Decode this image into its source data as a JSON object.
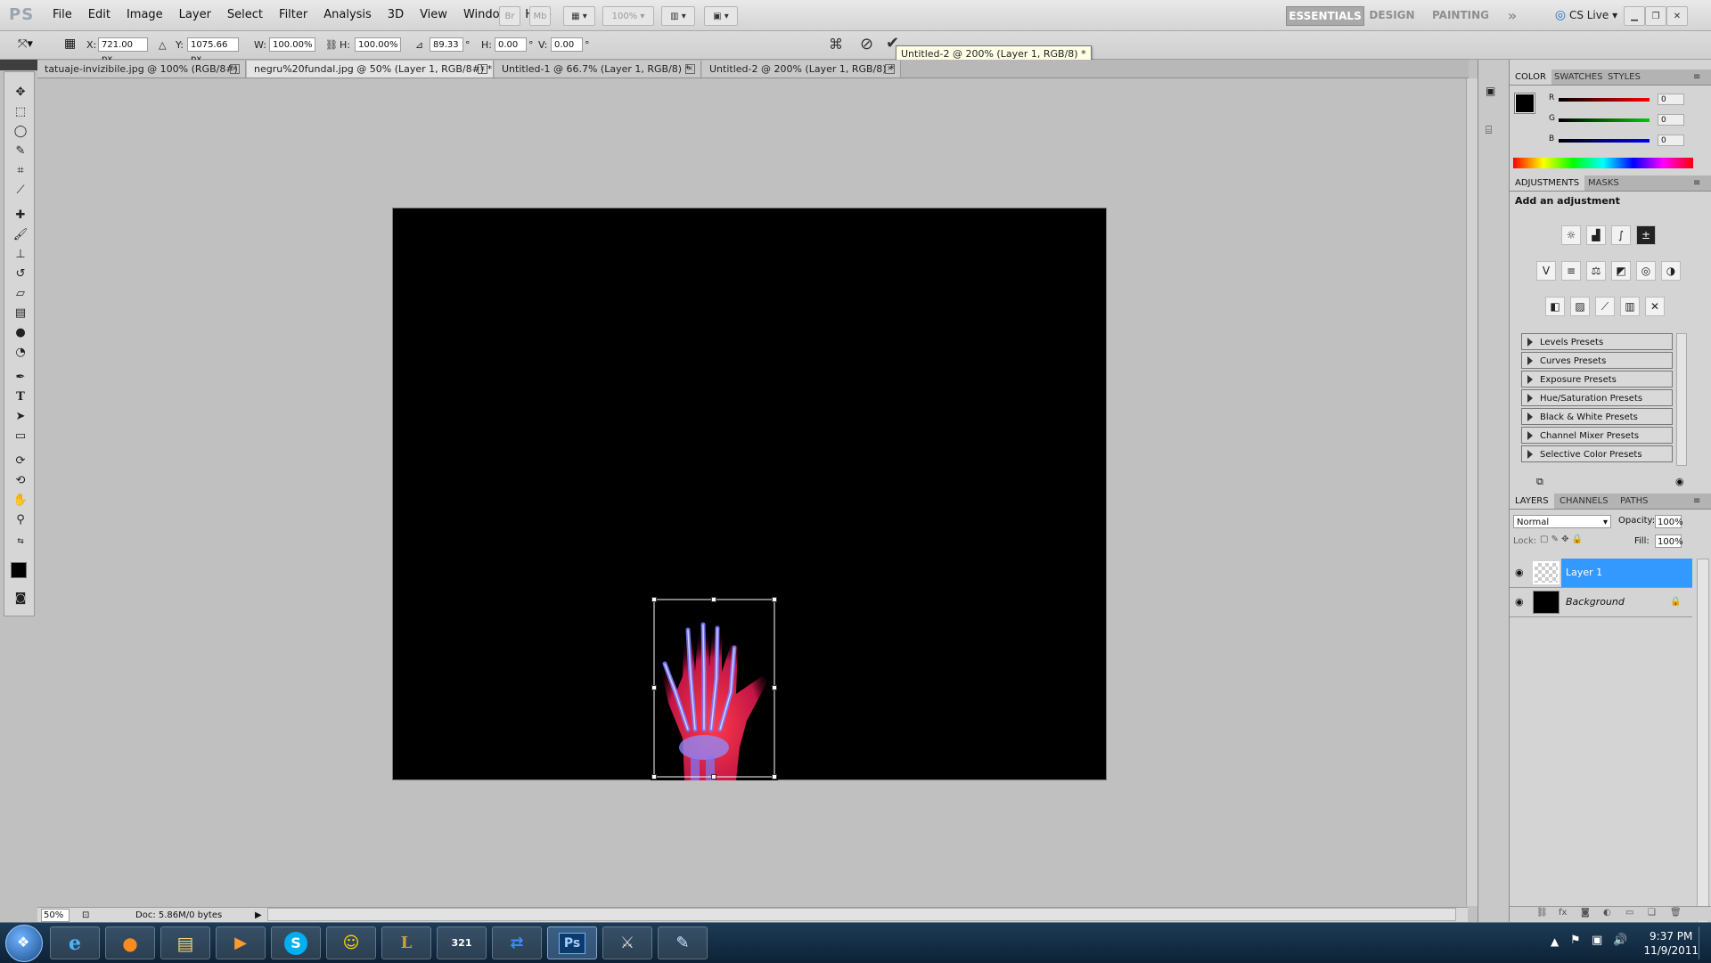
{
  "app": {
    "logo": "PS"
  },
  "menu": [
    "File",
    "Edit",
    "Image",
    "Layer",
    "Select",
    "Filter",
    "Analysis",
    "3D",
    "View",
    "Window",
    "Help"
  ],
  "zoom_dropdown": "100%",
  "workspaces": {
    "essentials": "ESSENTIALS",
    "design": "DESIGN",
    "painting": "PAINTING",
    "more": "»",
    "cslive": "CS Live"
  },
  "options": {
    "x_label": "X:",
    "x_value": "721.00 px",
    "y_label": "Y:",
    "y_value": "1075.66 px",
    "w_label": "W:",
    "w_value": "100.00%",
    "h_label": "H:",
    "h_value": "100.00%",
    "rot_value": "89.33",
    "rot_unit": "°",
    "hskew_label": "H:",
    "hskew_value": "0.00",
    "hskew_unit": "°",
    "vskew_label": "V:",
    "vskew_value": "0.00",
    "vskew_unit": "°"
  },
  "tooltip": "Untitled-2 @ 200% (Layer 1, RGB/8) *",
  "tabs": [
    {
      "label": "tatuaje-invizibile.jpg @ 100% (RGB/8#)"
    },
    {
      "label": "negru%20fundal.jpg @ 50% (Layer 1, RGB/8#) *"
    },
    {
      "label": "Untitled-1 @ 66.7% (Layer 1, RGB/8) *"
    },
    {
      "label": "Untitled-2 @ 200% (Layer 1, RGB/8) *"
    }
  ],
  "status": {
    "zoom": "50%",
    "doc": "Doc: 5.86M/0 bytes"
  },
  "color_panel": {
    "tabs": [
      "COLOR",
      "SWATCHES",
      "STYLES"
    ],
    "r_label": "R",
    "g_label": "G",
    "b_label": "B",
    "r_value": "0",
    "g_value": "0",
    "b_value": "0",
    "fg": "#000000",
    "bg": "#ffffff"
  },
  "adjustments": {
    "tabs": [
      "ADJUSTMENTS",
      "MASKS"
    ],
    "title": "Add an adjustment",
    "presets": [
      "Levels Presets",
      "Curves Presets",
      "Exposure Presets",
      "Hue/Saturation Presets",
      "Black & White Presets",
      "Channel Mixer Presets",
      "Selective Color Presets"
    ]
  },
  "layers": {
    "tabs": [
      "LAYERS",
      "CHANNELS",
      "PATHS"
    ],
    "blend_mode": "Normal",
    "opacity_label": "Opacity:",
    "opacity": "100%",
    "lock_label": "Lock:",
    "fill_label": "Fill:",
    "fill": "100%",
    "items": [
      {
        "name": "Layer 1"
      },
      {
        "name": "Background"
      }
    ]
  },
  "taskbar": {
    "time": "9:37 PM",
    "date": "11/9/2011",
    "icons": [
      "ie-icon",
      "firefox-icon",
      "explorer-icon",
      "media-icon",
      "skype-icon",
      "yahoo-icon",
      "league-icon",
      "media321-icon",
      "teamviewer-icon",
      "photoshop-icon",
      "game-icon",
      "notes-icon"
    ],
    "ps_label": "Ps",
    "media321_label": "321"
  },
  "accent": "#3399ff"
}
